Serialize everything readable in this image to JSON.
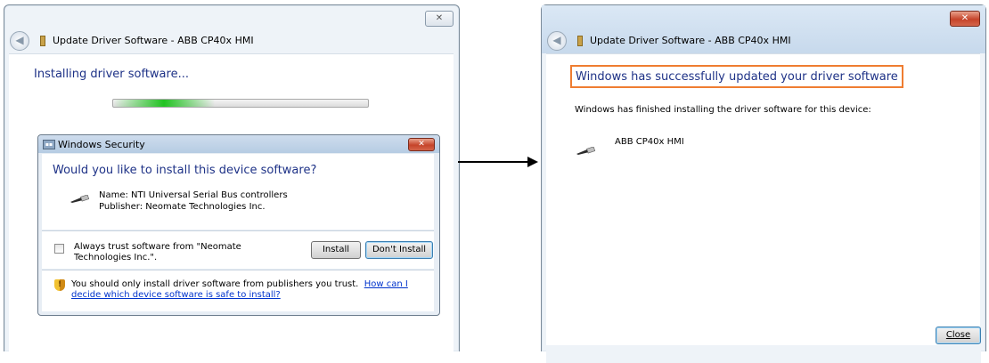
{
  "left_window": {
    "title": "Update Driver Software - ABB CP40x HMI",
    "close_glyph": "✕",
    "back_glyph": "◀",
    "heading": "Installing driver software...",
    "progress_fraction": 0.4
  },
  "security_dialog": {
    "title": "Windows Security",
    "close_glyph": "✕",
    "question": "Would you like to install this device software?",
    "name_line": "Name: NTI Universal Serial Bus controllers",
    "publisher_line": "Publisher: Neomate Technologies Inc.",
    "trust_checkbox_label": "Always trust software from \"Neomate Technologies Inc.\".",
    "trust_checked": false,
    "install_button": "Install",
    "dont_install_button": "Don't Install",
    "warning_text": "You should only install driver software from publishers you trust.",
    "warning_link": "How can I decide which device software is safe to install?",
    "shield_glyph": "!"
  },
  "right_window": {
    "title": "Update Driver Software - ABB CP40x HMI",
    "close_glyph": "✕",
    "back_glyph": "◀",
    "success_heading": "Windows has successfully updated your driver software",
    "finished_text": "Windows has finished installing the driver software for this device:",
    "device_name": "ABB CP40x HMI",
    "close_button": "Close"
  },
  "colors": {
    "heading_blue": "#1e3287",
    "highlight_orange": "#ef7d31",
    "progress_green": "#22c322"
  },
  "icons": {
    "usb": "usb-plug-icon",
    "shield": "shield-warning-icon"
  }
}
